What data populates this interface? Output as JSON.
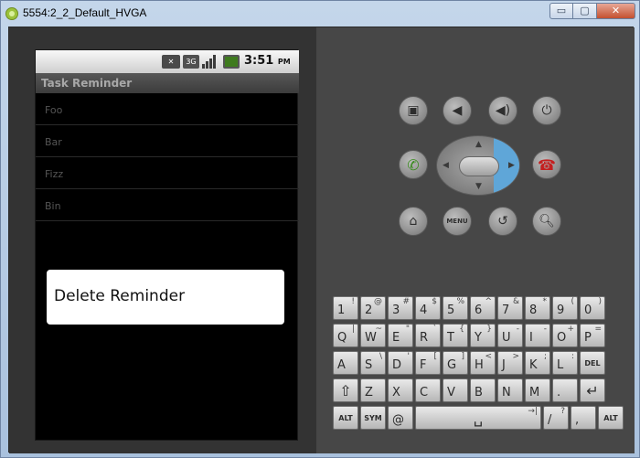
{
  "window": {
    "title": "5554:2_2_Default_HVGA",
    "controls": {
      "minimize": "▭",
      "maximize": "▢",
      "close": "✕"
    }
  },
  "statusbar": {
    "time": "3:51",
    "ampm": "PM",
    "icons": [
      "mute-icon",
      "3g-icon",
      "signal-icon",
      "battery-icon"
    ]
  },
  "app": {
    "title": "Task Reminder",
    "items": [
      "Foo",
      "Bar",
      "Fizz",
      "Bin"
    ]
  },
  "context_menu": {
    "item": "Delete Reminder"
  },
  "hardware_buttons": {
    "camera": "camera-icon",
    "volume_down": "volume-down-icon",
    "volume_up": "volume-up-icon",
    "power": "power-icon",
    "call": "call-icon",
    "end_call": "end-call-icon",
    "home": "home-icon",
    "menu": "MENU",
    "back": "back-icon",
    "search": "search-icon"
  },
  "keyboard": {
    "row1": [
      {
        "main": "1",
        "sup": "!"
      },
      {
        "main": "2",
        "sup": "@"
      },
      {
        "main": "3",
        "sup": "#"
      },
      {
        "main": "4",
        "sup": "$"
      },
      {
        "main": "5",
        "sup": "%"
      },
      {
        "main": "6",
        "sup": "^"
      },
      {
        "main": "7",
        "sup": "&"
      },
      {
        "main": "8",
        "sup": "*"
      },
      {
        "main": "9",
        "sup": "("
      },
      {
        "main": "0",
        "sup": ")"
      }
    ],
    "row2": [
      {
        "main": "Q",
        "sup": "|"
      },
      {
        "main": "W",
        "sup": "~"
      },
      {
        "main": "E",
        "sup": "\""
      },
      {
        "main": "R",
        "sup": "`"
      },
      {
        "main": "T",
        "sup": "{"
      },
      {
        "main": "Y",
        "sup": "}"
      },
      {
        "main": "U",
        "sup": "-"
      },
      {
        "main": "I",
        "sup": "-"
      },
      {
        "main": "O",
        "sup": "+"
      },
      {
        "main": "P",
        "sup": "="
      }
    ],
    "row3": [
      {
        "main": "A",
        "sup": ""
      },
      {
        "main": "S",
        "sup": "\\"
      },
      {
        "main": "D",
        "sup": "'"
      },
      {
        "main": "F",
        "sup": "["
      },
      {
        "main": "G",
        "sup": "]"
      },
      {
        "main": "H",
        "sup": "<"
      },
      {
        "main": "J",
        "sup": ">"
      },
      {
        "main": "K",
        "sup": ";"
      },
      {
        "main": "L",
        "sup": ":"
      },
      {
        "main": "DEL",
        "sup": ""
      }
    ],
    "row4": [
      {
        "main": "⇧",
        "sup": ""
      },
      {
        "main": "Z",
        "sup": ""
      },
      {
        "main": "X",
        "sup": ""
      },
      {
        "main": "C",
        "sup": ""
      },
      {
        "main": "V",
        "sup": ""
      },
      {
        "main": "B",
        "sup": ""
      },
      {
        "main": "N",
        "sup": ""
      },
      {
        "main": "M",
        "sup": ""
      },
      {
        "main": ".",
        "sup": ""
      },
      {
        "main": "↵",
        "sup": ""
      }
    ],
    "row5": [
      {
        "main": "ALT",
        "sup": ""
      },
      {
        "main": "SYM",
        "sup": ""
      },
      {
        "main": "@",
        "sup": ""
      },
      {
        "main": "␣",
        "sup": "→|"
      },
      {
        "main": "/",
        "sup": "?"
      },
      {
        "main": ",",
        "sup": ""
      },
      {
        "main": "ALT",
        "sup": ""
      }
    ]
  }
}
